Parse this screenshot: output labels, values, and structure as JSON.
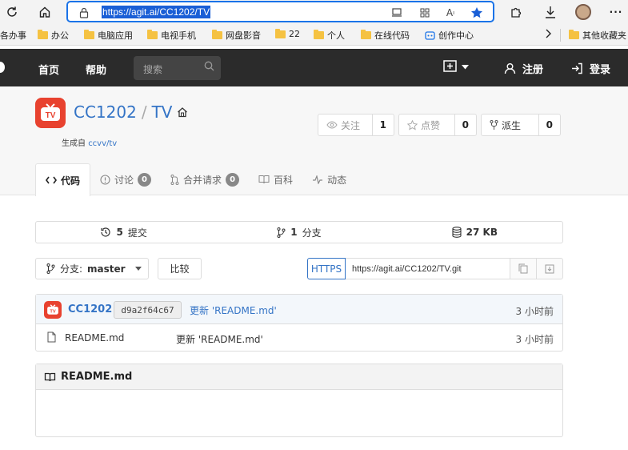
{
  "browser": {
    "url": "https://agit.ai/CC1202/TV",
    "bookmarks": [
      "各办事",
      "办公",
      "电脑应用",
      "电视手机",
      "网盘影音",
      "22",
      "个人",
      "在线代码",
      "创作中心",
      "其他收藏夹"
    ]
  },
  "nav": {
    "home": "首页",
    "help": "帮助",
    "search_placeholder": "搜索",
    "register": "注册",
    "login": "登录"
  },
  "repo": {
    "owner": "CC1202",
    "separator": "/",
    "name": "TV",
    "forked_prefix": "生成自",
    "forked_from": "ccvv/tv",
    "logo_text": "TV",
    "watch": {
      "label": "关注",
      "count": "1"
    },
    "star": {
      "label": "点赞",
      "count": "0"
    },
    "fork": {
      "label": "派生",
      "count": "0"
    }
  },
  "tabs": [
    {
      "label": "代码"
    },
    {
      "label": "讨论",
      "badge": "0"
    },
    {
      "label": "合并请求",
      "badge": "0"
    },
    {
      "label": "百科"
    },
    {
      "label": "动态"
    }
  ],
  "stats": {
    "commits": {
      "count": "5",
      "label": "提交"
    },
    "branches": {
      "count": "1",
      "label": "分支"
    },
    "size": {
      "count": "27 KB"
    }
  },
  "branch": {
    "prefix": "分支:",
    "name": "master"
  },
  "compare_label": "比较",
  "clone": {
    "protocol": "HTTPS",
    "url": "https://agit.ai/CC1202/TV.git"
  },
  "latest_commit": {
    "author": "CC1202",
    "sha": "d9a2f64c67",
    "message": "更新 'README.md'",
    "time": "3 小时前"
  },
  "files": [
    {
      "name": "README.md",
      "message": "更新 'README.md'",
      "time": "3 小时前"
    }
  ],
  "readme": {
    "title": "README.md"
  },
  "colors": {
    "accent": "#3474c6",
    "logo": "#e8422f",
    "nav_bg": "#2b2b2b"
  }
}
